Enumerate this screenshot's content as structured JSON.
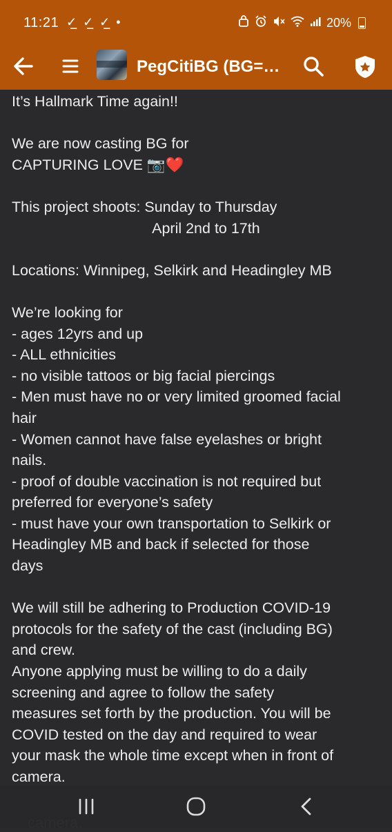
{
  "status_bar": {
    "time": "11:21",
    "notifications": "✓̲ ✓̲ ✓̲ •",
    "battery_percent": "20%"
  },
  "toolbar": {
    "title": "PegCitiBG (BG=B..."
  },
  "post": {
    "lines": [
      "It’s Hallmark Time again!!",
      "",
      "We are now casting BG for",
      "CAPTURING LOVE 📷❤️",
      "",
      "This project shoots: Sunday to Thursday",
      "                                  April 2nd to 17th",
      "",
      "Locations: Winnipeg, Selkirk and Headingley MB",
      "",
      "We’re looking for",
      "- ages 12yrs and up",
      "- ALL ethnicities",
      "- no visible tattoos or big facial piercings",
      "- Men must have no or very limited groomed facial",
      "hair",
      "- Women cannot have false eyelashes or bright",
      "nails.",
      "- proof of double vaccination is not required but",
      "preferred for everyone’s safety",
      "- must have your own transportation to Selkirk or",
      "Headingley MB and back if selected for those",
      "days",
      "",
      "We will still be adhering to Production COVID-19",
      "protocols for the safety of the cast (including BG)",
      "and crew.",
      "Anyone applying must be willing to do a daily",
      "screening and agree to follow the safety",
      "measures set forth by the production. You will be",
      "COVID tested on the day and required to wear",
      "your mask the whole time except when in front of",
      "camera."
    ],
    "peek": "camera."
  },
  "colors": {
    "accent": "#b35409",
    "background": "#2a2a2d",
    "text": "#ececec"
  }
}
